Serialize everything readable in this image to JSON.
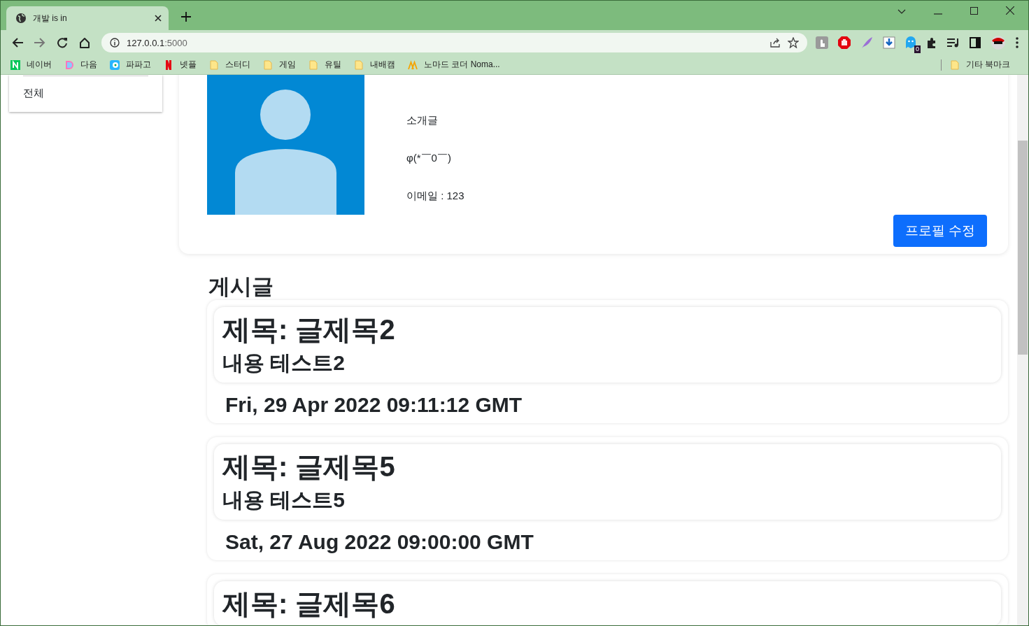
{
  "browser": {
    "tab": {
      "title": "개발 is in",
      "selected": true
    },
    "address": {
      "host": "127.0.0.1",
      "port": ":5000"
    },
    "bookmarks": [
      {
        "label": "네이버",
        "kind": "naver"
      },
      {
        "label": "다음",
        "kind": "daum"
      },
      {
        "label": "파파고",
        "kind": "papago"
      },
      {
        "label": "넷플",
        "kind": "netflix"
      },
      {
        "label": "스터디",
        "kind": "folder"
      },
      {
        "label": "게임",
        "kind": "folder"
      },
      {
        "label": "유틸",
        "kind": "folder"
      },
      {
        "label": "내배캠",
        "kind": "folder"
      },
      {
        "label": "노마드 코더 Noma...",
        "kind": "nomad"
      }
    ],
    "other_bookmarks": "기타 북마크",
    "extension_badge": "0"
  },
  "sidebar": {
    "items": [
      {
        "label": "전체"
      }
    ]
  },
  "profile": {
    "intro_label": "소개글",
    "intro": "φ(*￣0￣)",
    "email": "이메일 : 123",
    "edit_button": "프로필 수정"
  },
  "posts_heading": "게시글",
  "posts": [
    {
      "title": "제목: 글제목2",
      "content": "내용 테스트2",
      "date": "Fri, 29 Apr 2022 09:11:12 GMT"
    },
    {
      "title": "제목: 글제목5",
      "content": "내용 테스트5",
      "date": "Sat, 27 Aug 2022 09:00:00 GMT"
    },
    {
      "title": "제목: 글제목6"
    }
  ]
}
